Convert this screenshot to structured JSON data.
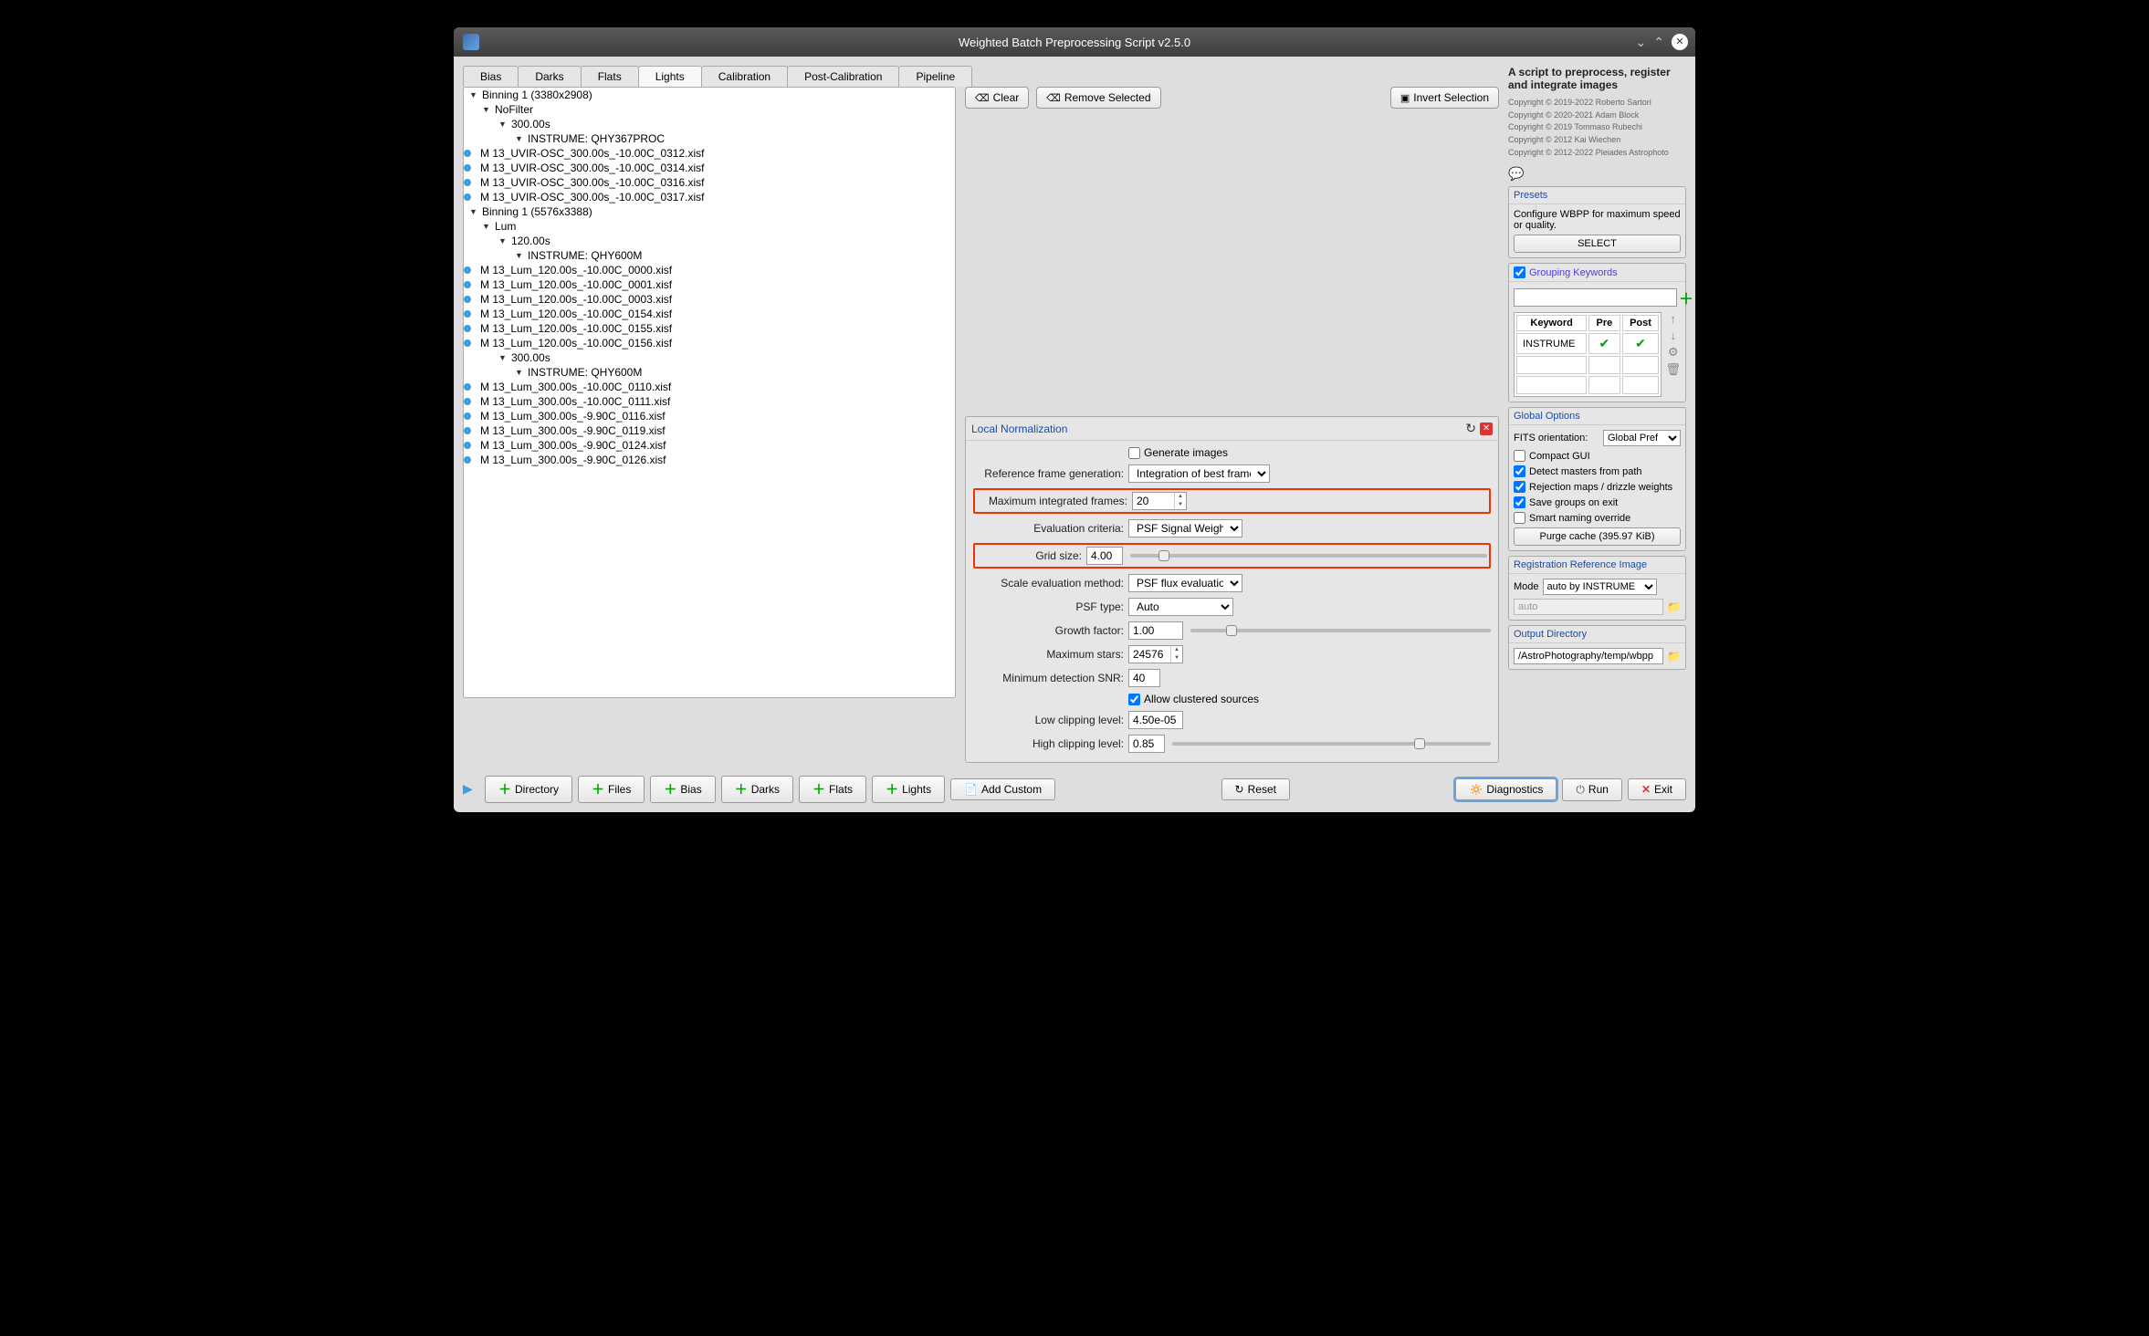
{
  "title": "Weighted Batch Preprocessing Script v2.5.0",
  "tabs": [
    "Bias",
    "Darks",
    "Flats",
    "Lights",
    "Calibration",
    "Post-Calibration",
    "Pipeline"
  ],
  "active_tab": "Lights",
  "top_buttons": {
    "clear": "Clear",
    "remove": "Remove Selected",
    "invert": "Invert Selection"
  },
  "tree": {
    "g1": "Binning 1 (3380x2908)",
    "g1_filter": "NoFilter",
    "g1_exp": "300.00s",
    "g1_instr": "INSTRUME: QHY367PROC",
    "g1_files": [
      "M 13_UVIR-OSC_300.00s_-10.00C_0312.xisf",
      "M 13_UVIR-OSC_300.00s_-10.00C_0314.xisf",
      "M 13_UVIR-OSC_300.00s_-10.00C_0316.xisf",
      "M 13_UVIR-OSC_300.00s_-10.00C_0317.xisf"
    ],
    "g2": "Binning 1 (5576x3388)",
    "g2_filter": "Lum",
    "g2_exp1": "120.00s",
    "g2_instr1": "INSTRUME: QHY600M",
    "g2_files1": [
      "M 13_Lum_120.00s_-10.00C_0000.xisf",
      "M 13_Lum_120.00s_-10.00C_0001.xisf",
      "M 13_Lum_120.00s_-10.00C_0003.xisf",
      "M 13_Lum_120.00s_-10.00C_0154.xisf",
      "M 13_Lum_120.00s_-10.00C_0155.xisf",
      "M 13_Lum_120.00s_-10.00C_0156.xisf"
    ],
    "g2_exp2": "300.00s",
    "g2_instr2": "INSTRUME: QHY600M",
    "g2_files2": [
      "M 13_Lum_300.00s_-10.00C_0110.xisf",
      "M 13_Lum_300.00s_-10.00C_0111.xisf",
      "M 13_Lum_300.00s_-9.90C_0116.xisf",
      "M 13_Lum_300.00s_-9.90C_0119.xisf",
      "M 13_Lum_300.00s_-9.90C_0124.xisf",
      "M 13_Lum_300.00s_-9.90C_0126.xisf"
    ]
  },
  "ln": {
    "title": "Local Normalization",
    "gen_images_label": "Generate images",
    "gen_images_checked": false,
    "ref_gen_label": "Reference frame generation:",
    "ref_gen_value": "Integration of best frames",
    "max_int_label": "Maximum integrated frames:",
    "max_int_value": "20",
    "eval_label": "Evaluation criteria:",
    "eval_value": "PSF Signal Weight",
    "grid_label": "Grid size:",
    "grid_value": "4.00",
    "scale_label": "Scale evaluation method:",
    "scale_value": "PSF flux evaluation",
    "psf_type_label": "PSF type:",
    "psf_type_value": "Auto",
    "growth_label": "Growth factor:",
    "growth_value": "1.00",
    "max_stars_label": "Maximum stars:",
    "max_stars_value": "24576",
    "min_snr_label": "Minimum detection SNR:",
    "min_snr_value": "40",
    "clustered_label": "Allow clustered sources",
    "clustered_checked": true,
    "low_clip_label": "Low clipping level:",
    "low_clip_value": "4.50e-05",
    "high_clip_label": "High clipping level:",
    "high_clip_value": "0.85"
  },
  "sidebar": {
    "title": "A script to preprocess, register and integrate images",
    "copyright": [
      "Copyright © 2019-2022 Roberto Sartori",
      "Copyright © 2020-2021 Adam Block",
      "Copyright © 2019 Tommaso Rubechi",
      "Copyright © 2012 Kai Wiechen",
      "Copyright © 2012-2022 Pleiades Astrophoto"
    ],
    "presets": {
      "header": "Presets",
      "text": "Configure WBPP for maximum speed or quality.",
      "btn": "SELECT"
    },
    "grouping": {
      "header": "Grouping Keywords",
      "checked": true,
      "col_kw": "Keyword",
      "col_pre": "Pre",
      "col_post": "Post",
      "row_kw": "INSTRUME"
    },
    "global": {
      "header": "Global Options",
      "fits_label": "FITS orientation:",
      "fits_value": "Global Pref",
      "compact": "Compact GUI",
      "detect": "Detect masters from path",
      "rejection": "Rejection maps / drizzle weights",
      "save": "Save groups on exit",
      "smart": "Smart naming override",
      "purge": "Purge cache (395.97 KiB)"
    },
    "regref": {
      "header": "Registration Reference Image",
      "mode_label": "Mode",
      "mode_value": "auto by INSTRUME",
      "auto": "auto"
    },
    "outdir": {
      "header": "Output Directory",
      "value": "/AstroPhotography/temp/wbpp"
    }
  },
  "bottom": {
    "dir": "Directory",
    "files": "Files",
    "bias": "Bias",
    "darks": "Darks",
    "flats": "Flats",
    "lights": "Lights",
    "custom": "Add Custom",
    "reset": "Reset",
    "diag": "Diagnostics",
    "run": "Run",
    "exit": "Exit"
  }
}
